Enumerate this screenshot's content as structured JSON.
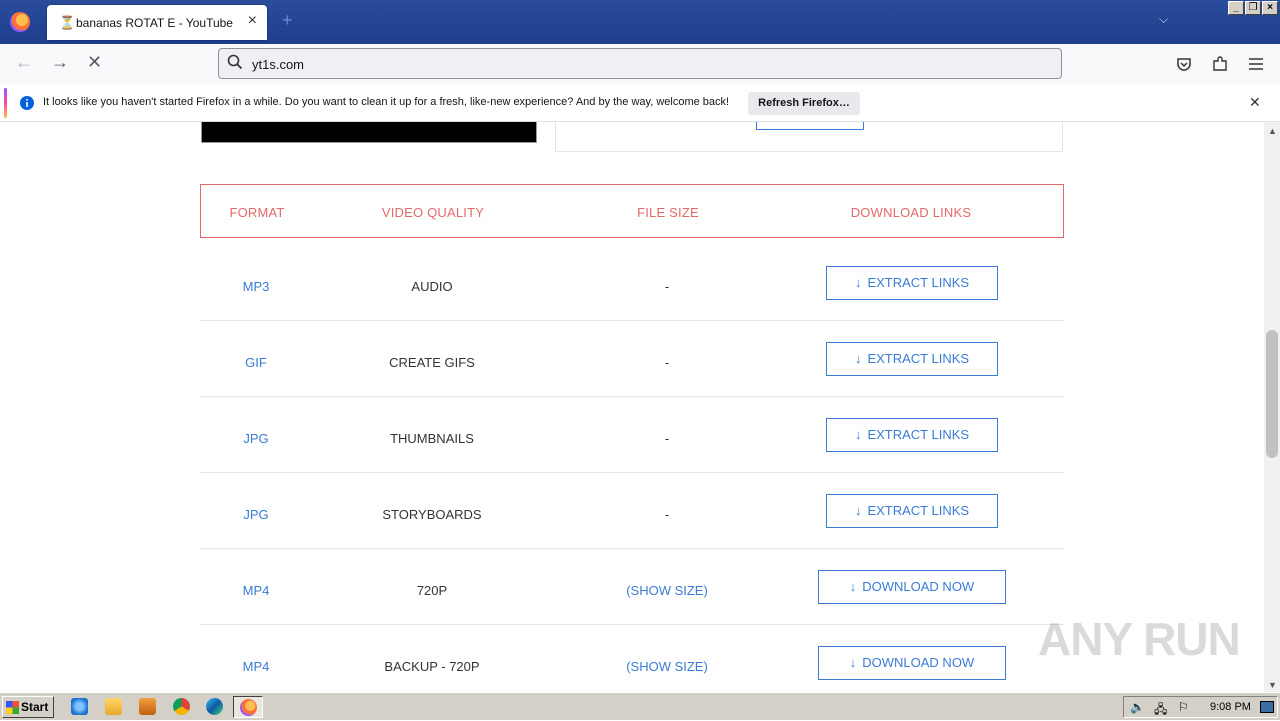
{
  "browser": {
    "tab_title": "bananas ROTAT E - YouTube",
    "url": "yt1s.com",
    "notification": {
      "message": "It looks like you haven't started Firefox in a while. Do you want to clean it up for a fresh, like-new experience? And by the way, welcome back!",
      "button": "Refresh Firefox…"
    }
  },
  "table": {
    "headers": [
      "FORMAT",
      "VIDEO QUALITY",
      "FILE SIZE",
      "DOWNLOAD LINKS"
    ],
    "rows": [
      {
        "format": "MP3",
        "quality": "AUDIO",
        "size": "-",
        "action": "EXTRACT LINKS"
      },
      {
        "format": "GIF",
        "quality": "CREATE GIFS",
        "size": "-",
        "action": "EXTRACT LINKS"
      },
      {
        "format": "JPG",
        "quality": "THUMBNAILS",
        "size": "-",
        "action": "EXTRACT LINKS"
      },
      {
        "format": "JPG",
        "quality": "STORYBOARDS",
        "size": "-",
        "action": "EXTRACT LINKS"
      },
      {
        "format": "MP4",
        "quality": "720P",
        "size": "(SHOW SIZE)",
        "action": "DOWNLOAD NOW"
      },
      {
        "format": "MP4",
        "quality": "BACKUP - 720P",
        "size": "(SHOW SIZE)",
        "action": "DOWNLOAD NOW"
      }
    ]
  },
  "watermark": "ANY RUN",
  "taskbar": {
    "start_label": "Start",
    "clock": "9:08 PM"
  },
  "colors": {
    "header_red": "#e26a6a",
    "link_blue": "#3a7bd5"
  }
}
